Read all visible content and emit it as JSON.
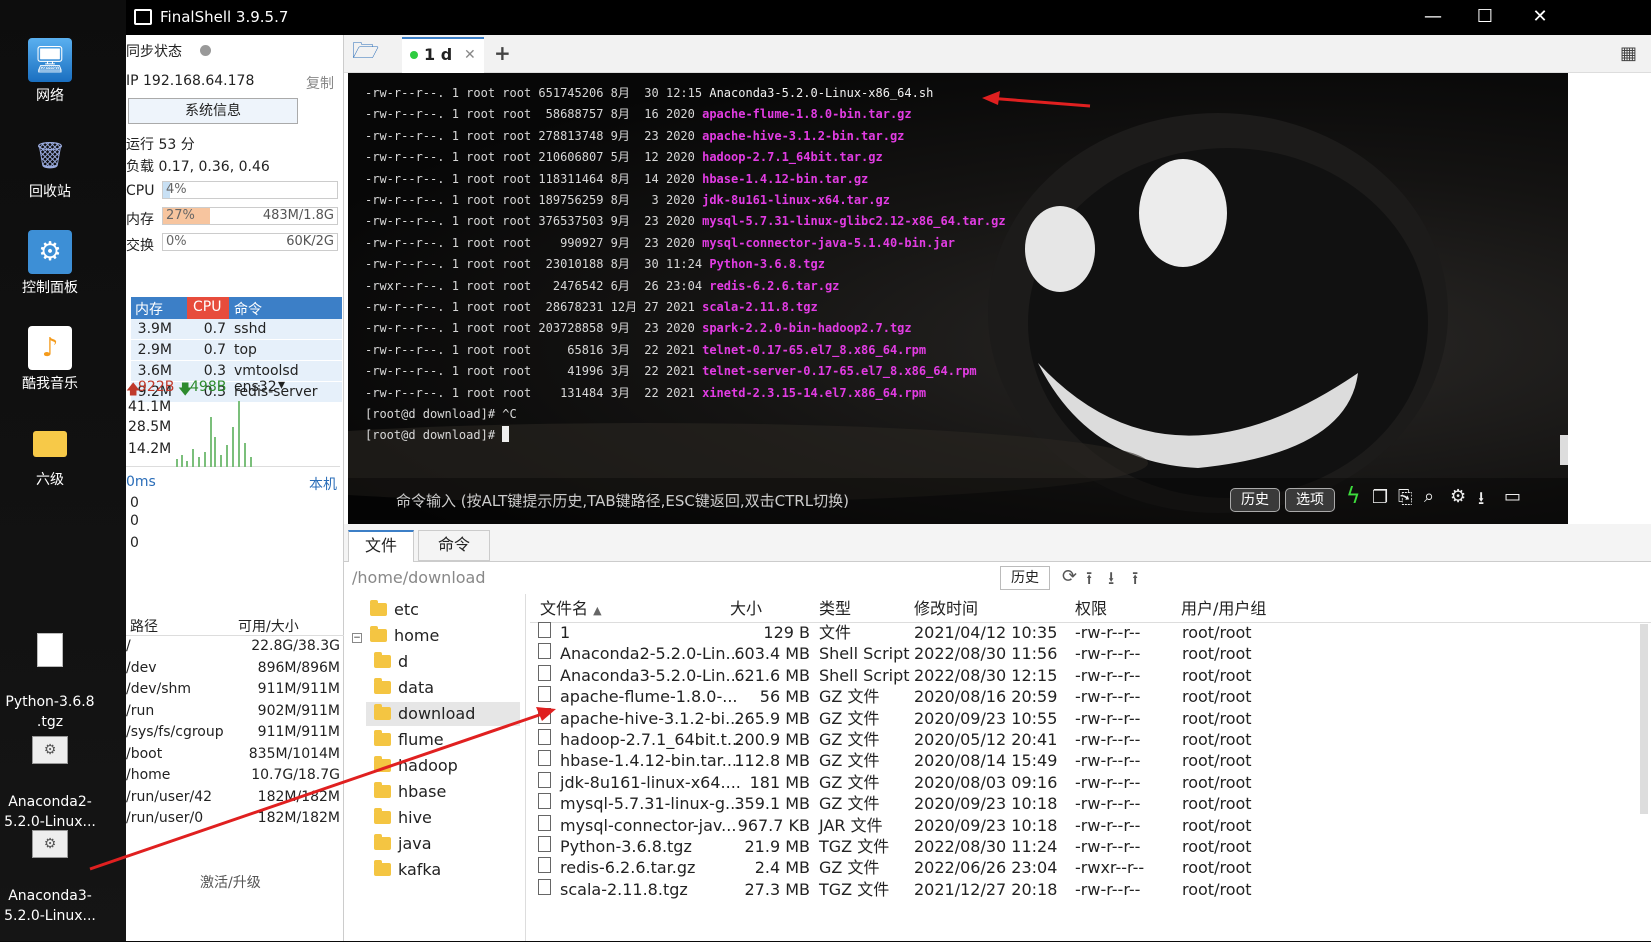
{
  "desktop": {
    "icons": [
      {
        "label": "网络",
        "icon": "network-monitor-icon"
      },
      {
        "label": "回收站",
        "icon": "recycle-bin-icon"
      },
      {
        "label": "控制面板",
        "icon": "control-panel-icon"
      },
      {
        "label": "酷我音乐",
        "icon": "music-app-icon"
      },
      {
        "label": "六级",
        "icon": "folder-icon"
      },
      {
        "label": "Python-3.6.8\n.tgz",
        "icon": "file-icon"
      },
      {
        "label": "Anaconda2-\n5.2.0-Linux...",
        "icon": "script-file-icon"
      },
      {
        "label": "Anaconda3-\n5.2.0-Linux...",
        "icon": "script-file-icon"
      }
    ]
  },
  "window": {
    "title": "FinalShell 3.9.5.7",
    "minimize": "—",
    "maximize": "☐",
    "close": "✕"
  },
  "left": {
    "sync_label": "同步状态",
    "ip": "IP 192.168.64.178",
    "copy": "复制",
    "sysinfo": "系统信息",
    "uptime": "运行 53 分",
    "load": "负载 0.17, 0.36, 0.46",
    "cpu": {
      "label": "CPU",
      "pct": "4%",
      "fraction": 0.04
    },
    "mem": {
      "label": "内存",
      "pct": "27%",
      "value": "483M/1.8G",
      "fraction": 0.27
    },
    "swap": {
      "label": "交换",
      "pct": "0%",
      "value": "60K/2G",
      "fraction": 0.0
    },
    "proc_headers": {
      "mem": "内存",
      "cpu": "CPU",
      "cmd": "命令"
    },
    "procs": [
      {
        "mem": "3.9M",
        "cpu": "0.7",
        "cmd": "sshd"
      },
      {
        "mem": "2.9M",
        "cpu": "0.7",
        "cmd": "top"
      },
      {
        "mem": "3.6M",
        "cpu": "0.3",
        "cmd": "vmtoolsd"
      },
      {
        "mem": "9.2M",
        "cpu": "0.3",
        "cmd": "redis-server"
      }
    ],
    "net": {
      "up": "922B",
      "down": "498B",
      "iface": "ens32",
      "scale": [
        "41.1M",
        "28.5M",
        "14.2M"
      ]
    },
    "ping": {
      "ms": "0ms",
      "host": "本机",
      "vals": [
        "0",
        "0",
        "0"
      ]
    },
    "disk_headers": {
      "path": "路径",
      "size": "可用/大小"
    },
    "disks": [
      {
        "path": "/",
        "size": "22.8G/38.3G"
      },
      {
        "path": "/dev",
        "size": "896M/896M"
      },
      {
        "path": "/dev/shm",
        "size": "911M/911M"
      },
      {
        "path": "/run",
        "size": "902M/911M"
      },
      {
        "path": "/sys/fs/cgroup",
        "size": "911M/911M"
      },
      {
        "path": "/boot",
        "size": "835M/1014M"
      },
      {
        "path": "/home",
        "size": "10.7G/18.7G"
      },
      {
        "path": "/run/user/42",
        "size": "182M/182M"
      },
      {
        "path": "/run/user/0",
        "size": "182M/182M"
      }
    ],
    "activate": "激活/升级"
  },
  "tabs": {
    "session": "1 d",
    "add": "+"
  },
  "terminal": {
    "lines": [
      {
        "meta": "-rw-r--r--. 1 root root 651745206 8月  30 12:15 ",
        "name": "Anaconda3-5.2.0-Linux-x86_64.sh",
        "white": true
      },
      {
        "meta": "-rw-r--r--. 1 root root  58688757 8月  16 2020 ",
        "name": "apache-flume-1.8.0-bin.tar.gz"
      },
      {
        "meta": "-rw-r--r--. 1 root root 278813748 9月  23 2020 ",
        "name": "apache-hive-3.1.2-bin.tar.gz"
      },
      {
        "meta": "-rw-r--r--. 1 root root 210606807 5月  12 2020 ",
        "name": "hadoop-2.7.1_64bit.tar.gz"
      },
      {
        "meta": "-rw-r--r--. 1 root root 118311464 8月  14 2020 ",
        "name": "hbase-1.4.12-bin.tar.gz"
      },
      {
        "meta": "-rw-r--r--. 1 root root 189756259 8月   3 2020 ",
        "name": "jdk-8u161-linux-x64.tar.gz"
      },
      {
        "meta": "-rw-r--r--. 1 root root 376537503 9月  23 2020 ",
        "name": "mysql-5.7.31-linux-glibc2.12-x86_64.tar.gz"
      },
      {
        "meta": "-rw-r--r--. 1 root root    990927 9月  23 2020 ",
        "name": "mysql-connector-java-5.1.40-bin.jar"
      },
      {
        "meta": "-rw-r--r--. 1 root root  23010188 8月  30 11:24 ",
        "name": "Python-3.6.8.tgz"
      },
      {
        "meta": "-rwxr--r--. 1 root root   2476542 6月  26 23:04 ",
        "name": "redis-6.2.6.tar.gz"
      },
      {
        "meta": "-rw-r--r--. 1 root root  28678231 12月 27 2021 ",
        "name": "scala-2.11.8.tgz"
      },
      {
        "meta": "-rw-r--r--. 1 root root 203728858 9月  23 2020 ",
        "name": "spark-2.2.0-bin-hadoop2.7.tgz"
      },
      {
        "meta": "-rw-r--r--. 1 root root     65816 3月  22 2021 ",
        "name": "telnet-0.17-65.el7_8.x86_64.rpm"
      },
      {
        "meta": "-rw-r--r--. 1 root root     41996 3月  22 2021 ",
        "name": "telnet-server-0.17-65.el7_8.x86_64.rpm"
      },
      {
        "meta": "-rw-r--r--. 1 root root    131484 3月  22 2021 ",
        "name": "xinetd-2.3.15-14.el7.x86_64.rpm"
      },
      {
        "meta": "[root@d download]# ^C",
        "name": ""
      },
      {
        "meta": "[root@d download]# ",
        "name": ""
      }
    ],
    "cmd_hint": "命令输入 (按ALT键提示历史,TAB键路径,ESC键返回,双击CTRL切换)",
    "history_btn": "历史",
    "options_btn": "选项"
  },
  "bottom": {
    "tab_files": "文件",
    "tab_cmd": "命令",
    "path": "/home/download",
    "history_btn": "历史",
    "tree": [
      {
        "name": "etc",
        "level": 1,
        "expanded": false
      },
      {
        "name": "home",
        "level": 1,
        "expanded": true
      },
      {
        "name": "d",
        "level": 2
      },
      {
        "name": "data",
        "level": 2
      },
      {
        "name": "download",
        "level": 2,
        "selected": true
      },
      {
        "name": "flume",
        "level": 2
      },
      {
        "name": "hadoop",
        "level": 2
      },
      {
        "name": "hbase",
        "level": 2
      },
      {
        "name": "hive",
        "level": 2
      },
      {
        "name": "java",
        "level": 2
      },
      {
        "name": "kafka",
        "level": 2
      }
    ],
    "file_headers": {
      "name": "文件名",
      "size": "大小",
      "type": "类型",
      "mtime": "修改时间",
      "perm": "权限",
      "owner": "用户/用户组"
    },
    "files": [
      {
        "name": "1",
        "size": "129 B",
        "type": "文件",
        "mtime": "2021/04/12 10:35",
        "perm": "-rw-r--r--",
        "owner": "root/root"
      },
      {
        "name": "Anaconda2-5.2.0-Lin...",
        "size": "603.4 MB",
        "type": "Shell Script",
        "mtime": "2022/08/30 11:56",
        "perm": "-rw-r--r--",
        "owner": "root/root"
      },
      {
        "name": "Anaconda3-5.2.0-Lin...",
        "size": "621.6 MB",
        "type": "Shell Script",
        "mtime": "2022/08/30 12:15",
        "perm": "-rw-r--r--",
        "owner": "root/root"
      },
      {
        "name": "apache-flume-1.8.0-...",
        "size": "56 MB",
        "type": "GZ 文件",
        "mtime": "2020/08/16 20:59",
        "perm": "-rw-r--r--",
        "owner": "root/root"
      },
      {
        "name": "apache-hive-3.1.2-bi...",
        "size": "265.9 MB",
        "type": "GZ 文件",
        "mtime": "2020/09/23 10:55",
        "perm": "-rw-r--r--",
        "owner": "root/root"
      },
      {
        "name": "hadoop-2.7.1_64bit.t...",
        "size": "200.9 MB",
        "type": "GZ 文件",
        "mtime": "2020/05/12 20:41",
        "perm": "-rw-r--r--",
        "owner": "root/root"
      },
      {
        "name": "hbase-1.4.12-bin.tar....",
        "size": "112.8 MB",
        "type": "GZ 文件",
        "mtime": "2020/08/14 15:49",
        "perm": "-rw-r--r--",
        "owner": "root/root"
      },
      {
        "name": "jdk-8u161-linux-x64....",
        "size": "181 MB",
        "type": "GZ 文件",
        "mtime": "2020/08/03 09:16",
        "perm": "-rw-r--r--",
        "owner": "root/root"
      },
      {
        "name": "mysql-5.7.31-linux-g...",
        "size": "359.1 MB",
        "type": "GZ 文件",
        "mtime": "2020/09/23 10:18",
        "perm": "-rw-r--r--",
        "owner": "root/root"
      },
      {
        "name": "mysql-connector-jav...",
        "size": "967.7 KB",
        "type": "JAR 文件",
        "mtime": "2020/09/23 10:18",
        "perm": "-rw-r--r--",
        "owner": "root/root"
      },
      {
        "name": "Python-3.6.8.tgz",
        "size": "21.9 MB",
        "type": "TGZ 文件",
        "mtime": "2022/08/30 11:24",
        "perm": "-rw-r--r--",
        "owner": "root/root"
      },
      {
        "name": "redis-6.2.6.tar.gz",
        "size": "2.4 MB",
        "type": "GZ 文件",
        "mtime": "2022/06/26 23:04",
        "perm": "-rwxr--r--",
        "owner": "root/root"
      },
      {
        "name": "scala-2.11.8.tgz",
        "size": "27.3 MB",
        "type": "TGZ 文件",
        "mtime": "2021/12/27 20:18",
        "perm": "-rw-r--r--",
        "owner": "root/root"
      }
    ]
  },
  "colors": {
    "accent": "#3c7fc7",
    "annotation": "#e02020",
    "term_filename": "#e23ce3",
    "mem_fill": "#f7c59f"
  }
}
